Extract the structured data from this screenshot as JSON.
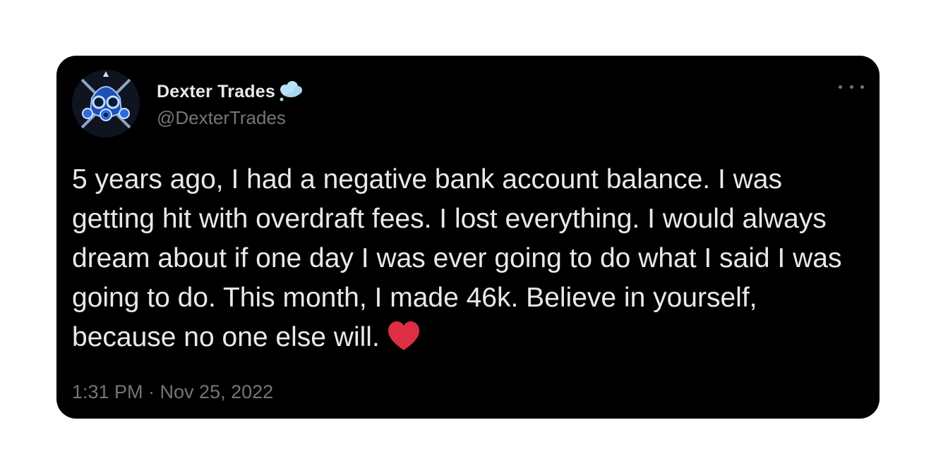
{
  "tweet": {
    "display_name": "Dexter Trades",
    "handle": "@DexterTrades",
    "text": "5 years ago, I had a negative bank account balance. I was getting hit with overdraft fees. I lost everything. I would always dream about if one day I was ever going to do what I said I was going to do. This month, I made 46k. Believe in yourself, because no one else will.",
    "timestamp": "1:31 PM · Nov 25, 2022"
  },
  "icons": {
    "avatar": "gas-mask-avatar",
    "name_emoji": "cloud-icon",
    "more": "more-options-icon",
    "text_emoji": "red-heart-icon"
  },
  "colors": {
    "card_background": "#000000",
    "primary_text": "#e7e9ea",
    "secondary_text": "#71767b",
    "heart": "#dd2e44",
    "cloud": "#a6d7f0"
  }
}
